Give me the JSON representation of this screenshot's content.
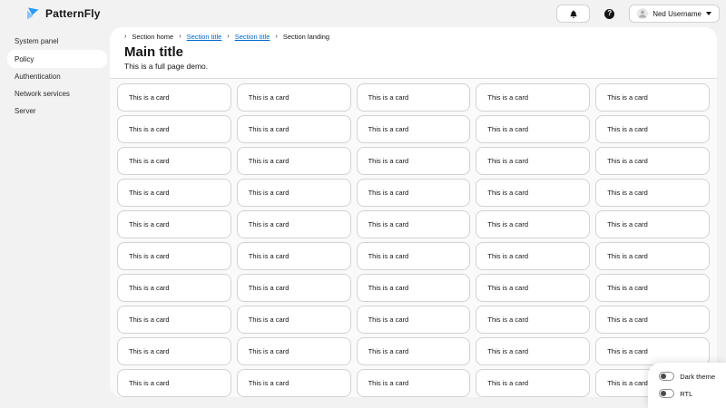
{
  "masthead": {
    "brand_name": "PatternFly",
    "help_glyph": "?",
    "user_name": "Ned Username"
  },
  "sidebar": {
    "items": [
      {
        "label": "System panel",
        "active": false
      },
      {
        "label": "Policy",
        "active": true
      },
      {
        "label": "Authentication",
        "active": false
      },
      {
        "label": "Network services",
        "active": false
      },
      {
        "label": "Server",
        "active": false
      }
    ]
  },
  "breadcrumb": {
    "separator": "›",
    "items": [
      {
        "label": "Section home",
        "link": false
      },
      {
        "label": "Section title",
        "link": true
      },
      {
        "label": "Section title",
        "link": true
      },
      {
        "label": "Section landing",
        "link": false
      }
    ]
  },
  "page": {
    "title": "Main title",
    "subtitle": "This is a full page demo."
  },
  "cards": {
    "text": "This is a card",
    "count": 50,
    "columns": 5,
    "rows": 10
  },
  "floating_toggles": [
    {
      "label": "Dark theme",
      "on": false
    },
    {
      "label": "RTL",
      "on": false
    }
  ],
  "colors": {
    "link": "#0066cc",
    "page_background": "#f2f2f2",
    "panel_background": "#ffffff",
    "card_border": "#d2d2d2",
    "text": "#151515",
    "brand_blue": "#2b9af3",
    "brand_blue_light": "#8bc1f7"
  }
}
